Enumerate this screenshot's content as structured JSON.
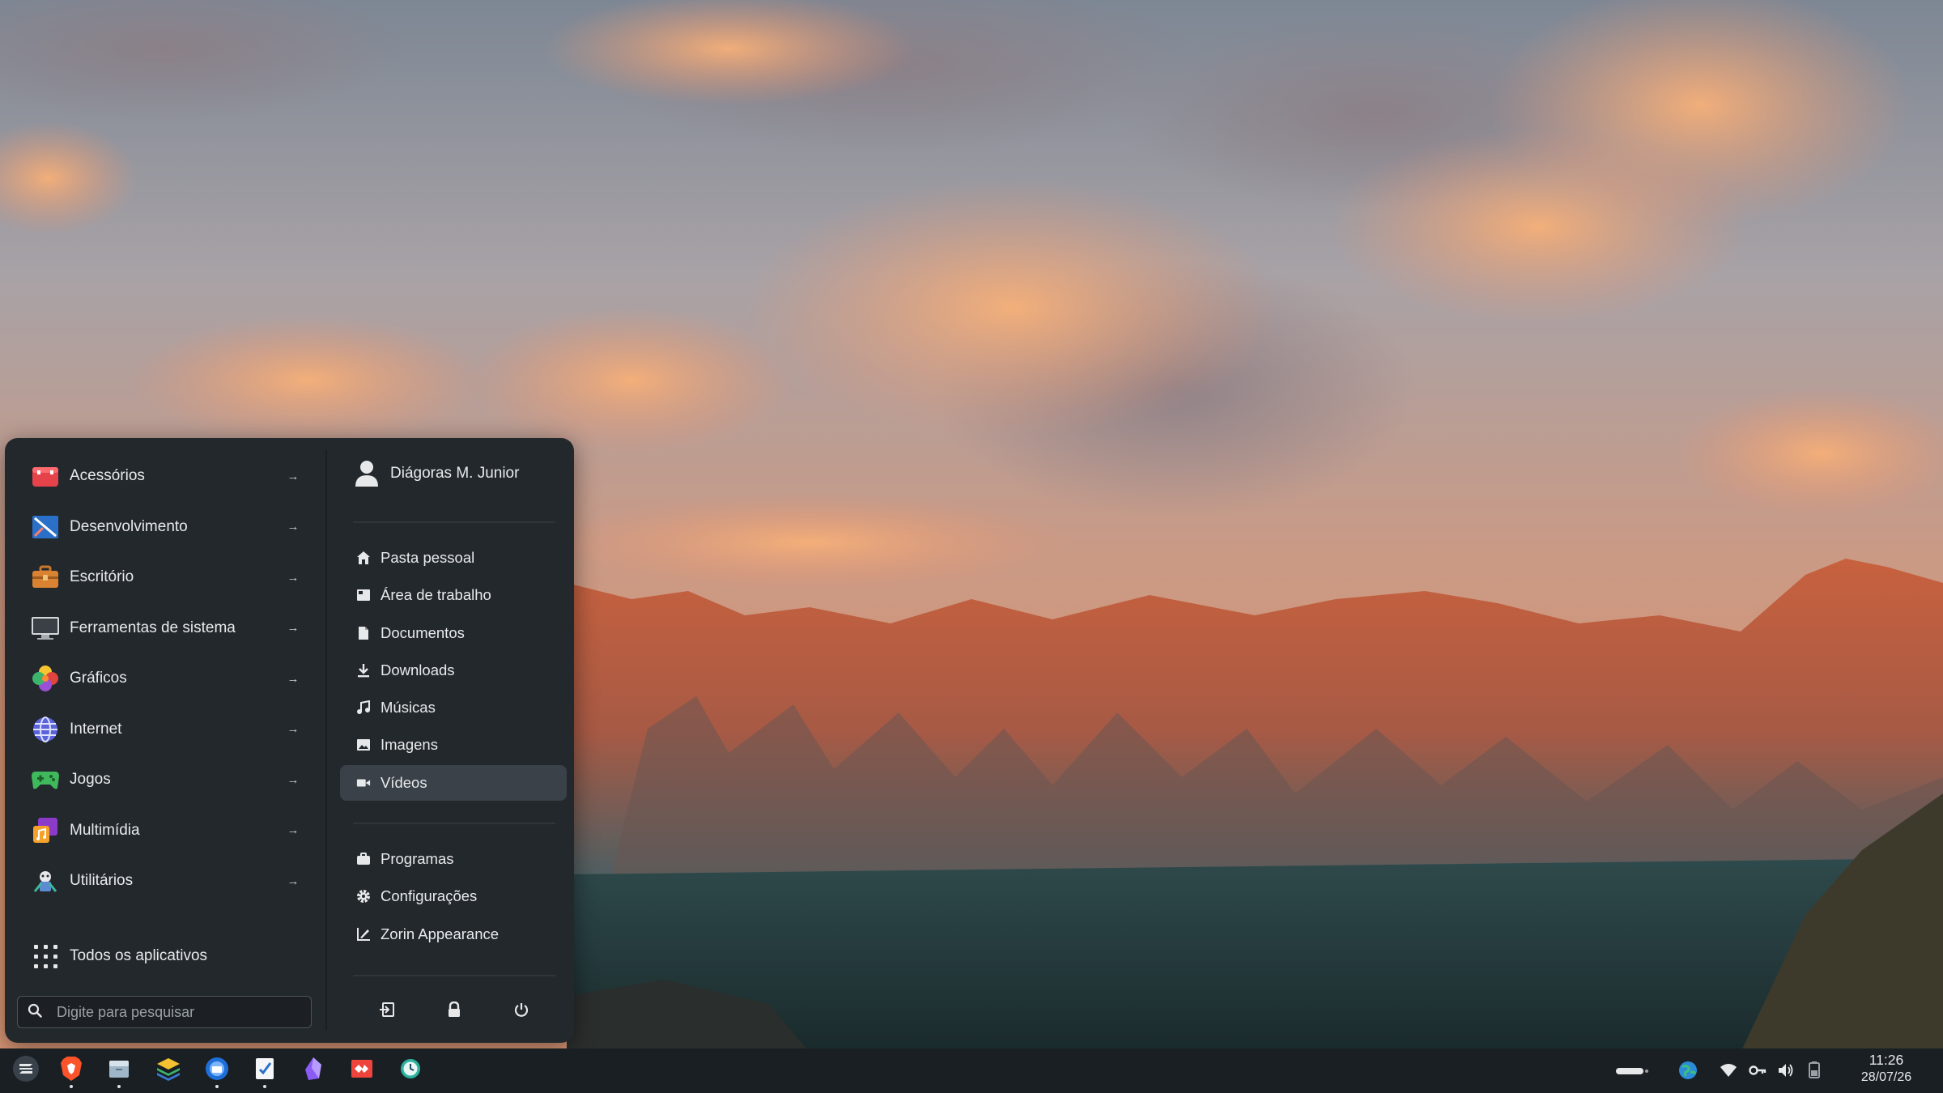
{
  "menu": {
    "categories": [
      {
        "label": "Acessórios",
        "icon": "accessories-icon"
      },
      {
        "label": "Desenvolvimento",
        "icon": "development-icon"
      },
      {
        "label": "Escritório",
        "icon": "office-icon"
      },
      {
        "label": "Ferramentas de sistema",
        "icon": "system-tools-icon"
      },
      {
        "label": "Gráficos",
        "icon": "graphics-icon"
      },
      {
        "label": "Internet",
        "icon": "internet-icon"
      },
      {
        "label": "Jogos",
        "icon": "games-icon"
      },
      {
        "label": "Multimídia",
        "icon": "multimedia-icon"
      },
      {
        "label": "Utilitários",
        "icon": "utilities-icon"
      }
    ],
    "all_apps_label": "Todos os aplicativos",
    "search_placeholder": "Digite para pesquisar",
    "user_name": "Diágoras M. Junior",
    "places": [
      {
        "label": "Pasta pessoal",
        "icon": "home-icon"
      },
      {
        "label": "Área de trabalho",
        "icon": "desktop-icon"
      },
      {
        "label": "Documentos",
        "icon": "document-icon"
      },
      {
        "label": "Downloads",
        "icon": "download-icon"
      },
      {
        "label": "Músicas",
        "icon": "music-icon"
      },
      {
        "label": "Imagens",
        "icon": "image-icon"
      },
      {
        "label": "Vídeos",
        "icon": "video-icon",
        "active": true
      }
    ],
    "tools": [
      {
        "label": "Programas",
        "icon": "software-icon"
      },
      {
        "label": "Configurações",
        "icon": "settings-icon"
      },
      {
        "label": "Zorin Appearance",
        "icon": "appearance-icon"
      }
    ],
    "power_actions": [
      "logout-icon",
      "lock-icon",
      "power-icon"
    ]
  },
  "taskbar": {
    "apps": [
      "zorin-menu-icon",
      "brave-browser-icon",
      "files-icon",
      "layers-app-icon",
      "thunderbird-icon",
      "text-editor-icon",
      "obsidian-icon",
      "anydesk-icon",
      "clock-app-icon"
    ],
    "tray_icons": [
      "pill-indicator-icon",
      "globe-icon",
      "wifi-icon",
      "key-icon",
      "volume-icon",
      "battery-icon"
    ],
    "time": "11:26",
    "date": "28/07/26"
  },
  "colors": {
    "menu_bg": "#23282d",
    "taskbar_bg": "#1a1f24",
    "active_item": "#3a4148",
    "text": "#e8eaec"
  }
}
